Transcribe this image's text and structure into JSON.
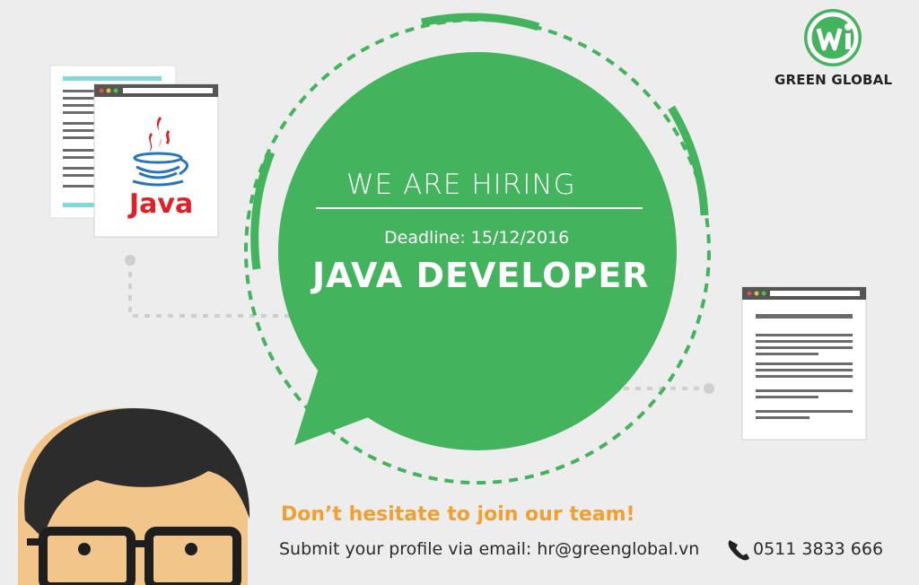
{
  "brand": {
    "name": "GREEN GLOBAL",
    "colors": {
      "green": "#43b35d",
      "orange": "#f0a030",
      "java_red": "#e01f26",
      "java_blue": "#2a74b8"
    }
  },
  "bubble": {
    "heading": "WE ARE HIRING",
    "deadline": "Deadline: 15/12/2016",
    "position": "JAVA DEVELOPER"
  },
  "java_logo_text": "Java",
  "footer": {
    "tagline": "Don’t hesitate to join our team!",
    "submit_line": "Submit your profile via email: hr@greenglobal.vn",
    "phone": "0511 3833 666"
  },
  "icons": [
    "brand-logo-icon",
    "java-cup-icon",
    "phone-icon",
    "browser-window-icon",
    "document-icon"
  ]
}
